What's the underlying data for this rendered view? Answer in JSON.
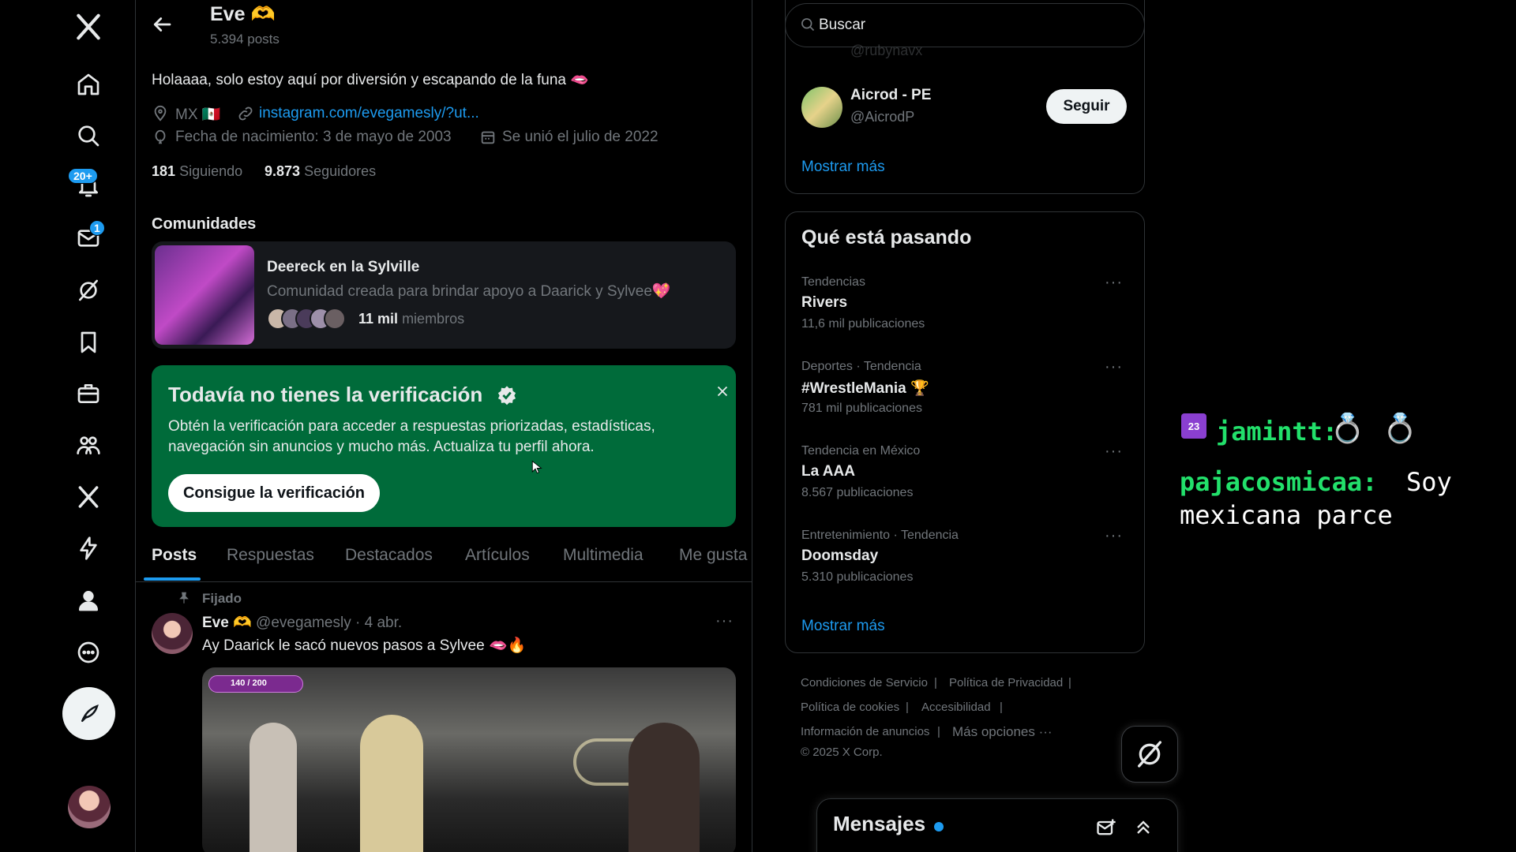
{
  "nav": {
    "notifications_badge": "20+",
    "messages_badge": "1"
  },
  "header": {
    "name": "Eve",
    "name_emoji": "🫶",
    "posts_count": "5.394 posts"
  },
  "profile": {
    "bio": "Holaaaa, solo estoy aquí por diversión y escapando de la funa 🫦",
    "location": "MX 🇲🇽",
    "website": "instagram.com/evegamesly/?ut...",
    "birthday": "Fecha de nacimiento: 3 de mayo de 2003",
    "joined": "Se unió el julio de 2022",
    "following_count": "181",
    "following_label": "Siguiendo",
    "followers_count": "9.873",
    "followers_label": "Seguidores"
  },
  "communities": {
    "heading": "Comunidades",
    "card": {
      "name": "Deereck en la Sylville",
      "description": "Comunidad creada para brindar apoyo a Daarick y Sylvee💖",
      "members_count": "11 mil",
      "members_label": "miembros"
    }
  },
  "verification": {
    "title": "Todavía no tienes la verificación",
    "body_line1": "Obtén la verificación para acceder a respuestas priorizadas, estadísticas,",
    "body_line2": "navegación sin anuncios y mucho más. Actualiza tu perfil ahora.",
    "button": "Consigue la verificación"
  },
  "tabs": [
    "Posts",
    "Respuestas",
    "Destacados",
    "Artículos",
    "Multimedia",
    "Me gusta"
  ],
  "post": {
    "pinned_label": "Fijado",
    "author": "Eve",
    "author_emoji": "🫶",
    "handle": "@evegamesly",
    "date": "· 4 abr.",
    "text": "Ay Daarick le sacó nuevos pasos a Sylvee 🫦🔥",
    "media_overlay": "140 / 200"
  },
  "search": {
    "placeholder": "Buscar"
  },
  "who_to_follow": {
    "prev_handle": "@rubynavx",
    "account_name": "Aicrod - PE",
    "account_handle": "@AicrodP",
    "follow_label": "Seguir",
    "show_more": "Mostrar más"
  },
  "trends": {
    "heading": "Qué está pasando",
    "items": [
      {
        "context": "Tendencias",
        "title": "Rivers",
        "count": "11,6 mil publicaciones"
      },
      {
        "context": "Deportes · Tendencia",
        "title": "#WrestleMania 🏆",
        "count": "781 mil publicaciones"
      },
      {
        "context": "Tendencia en México",
        "title": "La AAA",
        "count": "8.567 publicaciones"
      },
      {
        "context": "Entretenimiento · Tendencia",
        "title": "Doomsday",
        "count": "5.310 publicaciones"
      }
    ],
    "show_more": "Mostrar más"
  },
  "footer": {
    "terms": "Condiciones de Servicio",
    "privacy": "Política de Privacidad",
    "cookies": "Política de cookies",
    "accessibility": "Accesibilidad",
    "ads_info": "Información de anuncios",
    "more": "Más opciones ···",
    "copyright": "© 2025 X Corp."
  },
  "messages_dock": {
    "title": "Mensajes"
  },
  "chat_overlay": {
    "line1_user": "jamintt:",
    "line1_emotes": "💍 💍",
    "line2_user": "pajacosmicaa:",
    "line2_text_a": "Soy",
    "line2_text_b": "mexicana parce"
  },
  "colors": {
    "accent": "#1d9bf0",
    "verification_green": "#006b3a",
    "chat_green": "#22e06b"
  }
}
